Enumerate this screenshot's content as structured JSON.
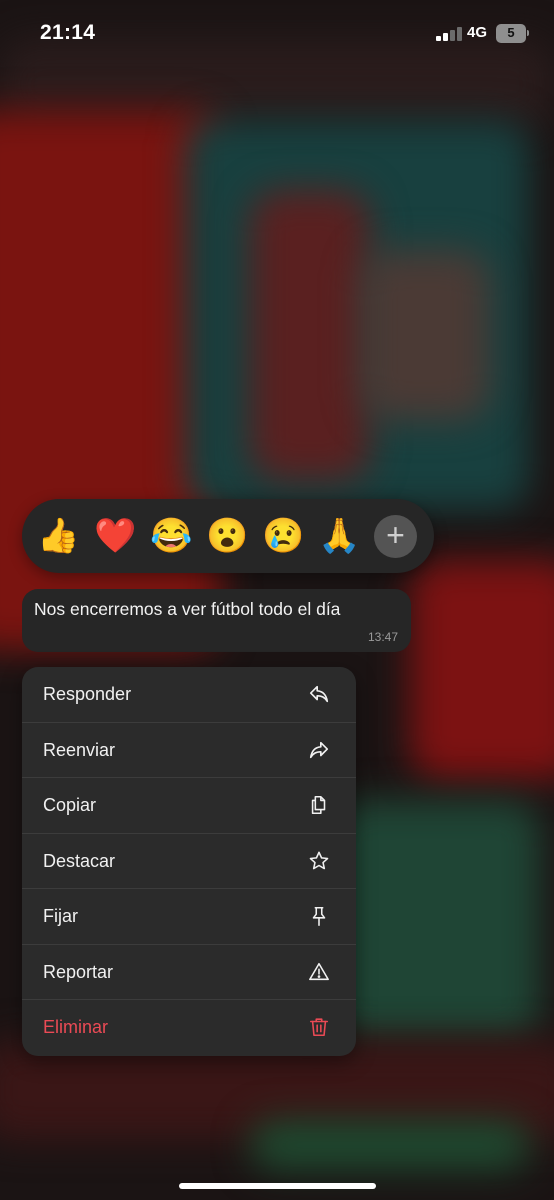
{
  "status_bar": {
    "time": "21:14",
    "network": "4G",
    "battery": "5"
  },
  "reactions": {
    "emojis": [
      "👍",
      "❤️",
      "😂",
      "😮",
      "😢",
      "🙏"
    ],
    "more_label": "+"
  },
  "message": {
    "text": "Nos encerremos a ver fútbol todo el día",
    "time": "13:47"
  },
  "menu": {
    "items": [
      {
        "label": "Responder",
        "icon": "reply-icon"
      },
      {
        "label": "Reenviar",
        "icon": "forward-icon"
      },
      {
        "label": "Copiar",
        "icon": "copy-icon"
      },
      {
        "label": "Destacar",
        "icon": "star-icon"
      },
      {
        "label": "Fijar",
        "icon": "pin-icon"
      },
      {
        "label": "Reportar",
        "icon": "warning-icon"
      },
      {
        "label": "Eliminar",
        "icon": "trash-icon"
      }
    ],
    "danger_color": "#ea4a55"
  }
}
